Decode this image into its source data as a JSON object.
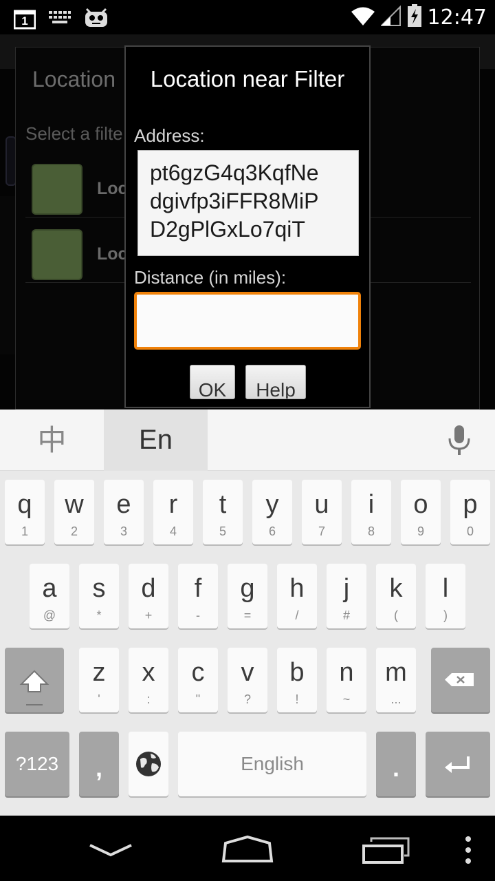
{
  "status_bar": {
    "notif_badge": "1",
    "clock": "12:47",
    "icons": [
      "notification-count-icon",
      "keyboard-icon",
      "cyanogen-mascot-icon",
      "wifi-icon",
      "cell-signal-icon",
      "battery-charging-icon"
    ]
  },
  "background": {
    "dialog_title": "Location",
    "subtitle": "Select a filte",
    "rows": [
      {
        "label": "Loca"
      },
      {
        "label": "Location away"
      }
    ]
  },
  "dialog": {
    "title": "Location near Filter",
    "address_label": "Address:",
    "address_lines": [
      "pt6gzG4q3KqfNe",
      "dgivfp3iFFR8MiP",
      "D2gPlGxLo7qiT"
    ],
    "distance_label": "Distance (in miles):",
    "distance_value": "",
    "ok_label": "OK",
    "help_label": "Help"
  },
  "keyboard": {
    "tab_chinese": "中",
    "tab_english": "En",
    "row1": [
      {
        "k": "q",
        "s": "1"
      },
      {
        "k": "w",
        "s": "2"
      },
      {
        "k": "e",
        "s": "3"
      },
      {
        "k": "r",
        "s": "4"
      },
      {
        "k": "t",
        "s": "5"
      },
      {
        "k": "y",
        "s": "6"
      },
      {
        "k": "u",
        "s": "7"
      },
      {
        "k": "i",
        "s": "8"
      },
      {
        "k": "o",
        "s": "9"
      },
      {
        "k": "p",
        "s": "0"
      }
    ],
    "row2": [
      {
        "k": "a",
        "s": "@"
      },
      {
        "k": "s",
        "s": "*"
      },
      {
        "k": "d",
        "s": "+"
      },
      {
        "k": "f",
        "s": "-"
      },
      {
        "k": "g",
        "s": "="
      },
      {
        "k": "h",
        "s": "/"
      },
      {
        "k": "j",
        "s": "#"
      },
      {
        "k": "k",
        "s": "("
      },
      {
        "k": "l",
        "s": ")"
      }
    ],
    "row3": [
      {
        "k": "z",
        "s": "'"
      },
      {
        "k": "x",
        "s": ":"
      },
      {
        "k": "c",
        "s": "\""
      },
      {
        "k": "v",
        "s": "?"
      },
      {
        "k": "b",
        "s": "!"
      },
      {
        "k": "n",
        "s": "~"
      },
      {
        "k": "m",
        "s": "..."
      }
    ],
    "symbols_label": "?123",
    "comma_label": ",",
    "space_label": "English",
    "period_label": "."
  },
  "colors": {
    "accent_orange": "#f0820a",
    "swatch_green": "#4a5e36"
  }
}
